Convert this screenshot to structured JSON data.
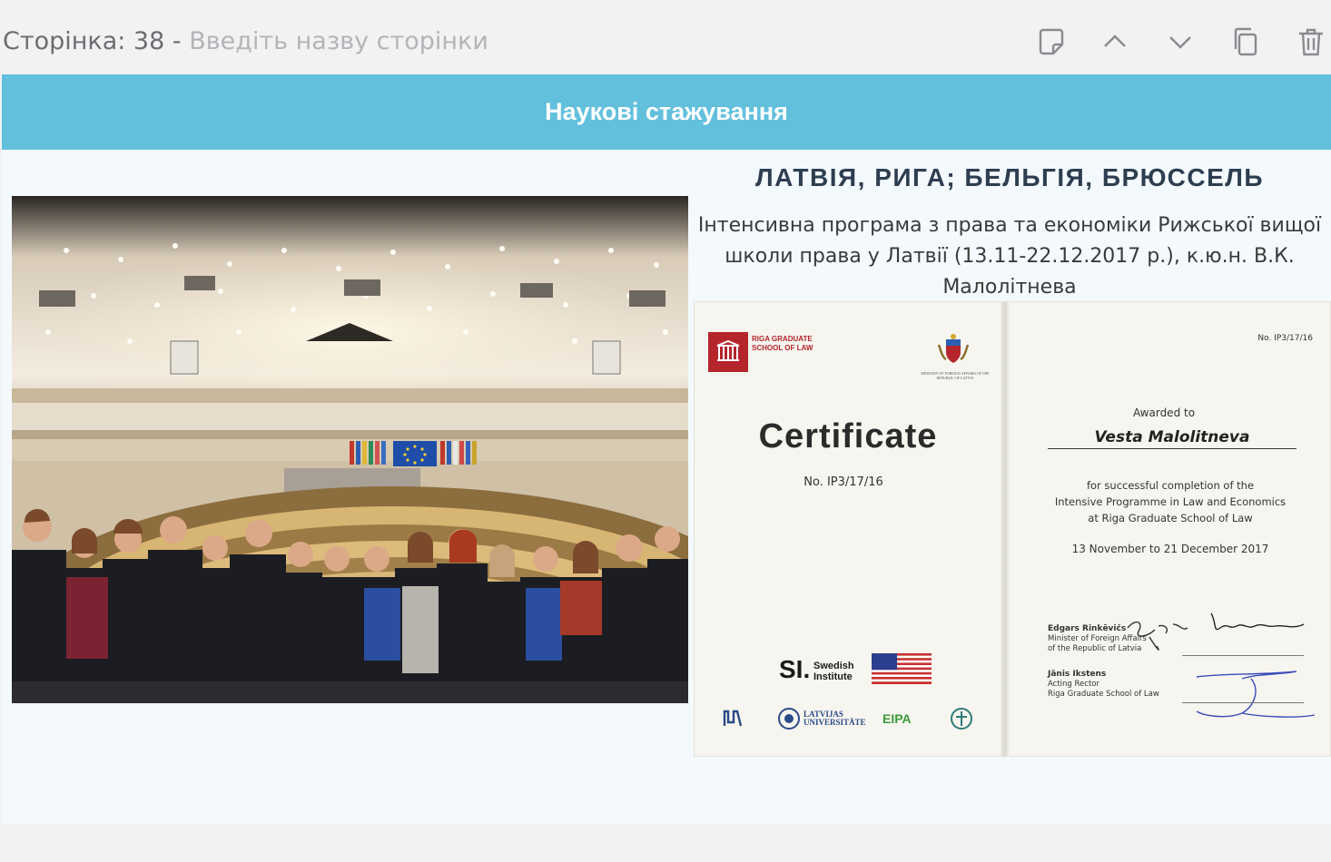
{
  "toolbar": {
    "page_prefix": "Сторінка: 38 - ",
    "page_title_placeholder": "Введіть назву сторінки",
    "icons": [
      "note-icon",
      "chevron-up-icon",
      "chevron-down-icon",
      "copy-icon",
      "trash-icon"
    ]
  },
  "slide": {
    "header_title": "Наукові стажування",
    "location": "ЛАТВІЯ, РИГА; БЕЛЬГІЯ, БРЮССЕЛЬ",
    "description": "Інтенсивна програма з права та економіки Рижської вищої школи права у Латвії (13.11-22.12.2017 р.), к.ю.н. В.К. Малолітнева"
  },
  "certificate": {
    "school_name": "RIGA GRADUATE SCHOOL OF LAW",
    "ministry": "MINISTRY OF FOREIGN AFFAIRS OF THE REPUBLIC OF LATVIA",
    "title": "Certificate",
    "number_left": "No. IP3/17/16",
    "number_right": "No. IP3/17/16",
    "awarded_to": "Awarded to",
    "awardee": "Vesta Malolitneva",
    "completion_line1": "for successful completion of the",
    "completion_line2": "Intensive Programme in Law and Economics",
    "completion_line3": "at Riga Graduate School of Law",
    "dates": "13 November to 21 December 2017",
    "signer1_name": "Edgars Rinkēvičs",
    "signer1_role1": "Minister of Foreign Affairs",
    "signer1_role2": "of the Republic of Latvia",
    "signer2_name": "Jānis Ikstens",
    "signer2_role1": "Acting Rector",
    "signer2_role2": "Riga Graduate School of Law",
    "si_logo": "SI.",
    "si_line1": "Swedish",
    "si_line2": "Institute",
    "partner_lu": "LATVIJAS UNIVERSITĀTE",
    "partner_eipa": "EIPA"
  },
  "colors": {
    "header_bg": "#62c0dd",
    "slide_bg": "#f4f9fd",
    "location_text": "#2d3e50",
    "rgsl_red": "#b5252c"
  }
}
